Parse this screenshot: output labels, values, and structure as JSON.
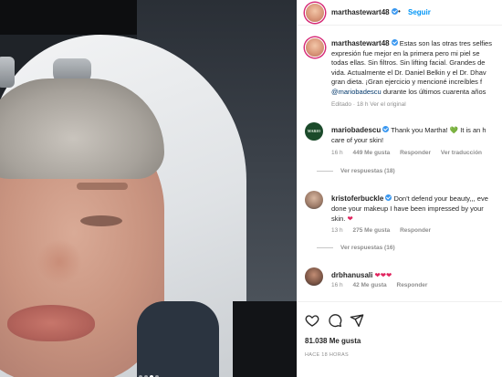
{
  "post": {
    "author": "marthastewart48",
    "follow_label": "Seguir",
    "separator": "•",
    "caption_lines": [
      "Estas son las otras tres selfies",
      "expresión fue mejor en la primera pero mi piel se",
      "todas ellas. Sin filtros. Sin lifting facial. Grandes de",
      "vida. Actualmente el Dr. Daniel Belkin y el Dr. Dhav",
      "gran dieta. ¡Gran ejercicio y mencioné increíbles f"
    ],
    "caption_mention": "@mariobadescu",
    "caption_last_tail": " durante los últimos cuarenta años",
    "caption_meta": "Editado · 18 h   Ver el original",
    "image_dots_count": 4,
    "image_dots_active": 2
  },
  "comments": [
    {
      "author": "mariobadescu",
      "avatar_text": "MARIO BADESCU",
      "line1": "Thank you Martha!",
      "heart": "💚",
      "line1_tail": " It is an h",
      "line2": "care of your skin!",
      "time": "16 h",
      "likes": "449 Me gusta",
      "reply": "Responder",
      "translate": "Ver traducción",
      "replies": "Ver respuestas (18)"
    },
    {
      "author": "kristoferbuckle",
      "line1": "Don't defend your beauty,,, eve",
      "line2": "done your makeup I have been impressed by your",
      "line3": "skin.",
      "heart": "❤",
      "time": "13 h",
      "likes": "275 Me gusta",
      "reply": "Responder",
      "replies": "Ver respuestas (16)"
    },
    {
      "author": "drbhanusali",
      "hearts": "❤❤❤",
      "time": "16 h",
      "likes": "42 Me gusta",
      "reply": "Responder"
    }
  ],
  "actions": {
    "icons": [
      "heart-icon",
      "comment-icon",
      "share-icon"
    ],
    "likes": "81.038 Me gusta",
    "posted_ago": "HACE 18 HORAS"
  },
  "colors": {
    "link_blue": "#0095f6",
    "verified_blue": "#3897f0",
    "muted_gray": "#8e8e8e",
    "text_dark": "#262626",
    "heart_red": "#e0245e",
    "heart_green": "#2bb24c"
  }
}
